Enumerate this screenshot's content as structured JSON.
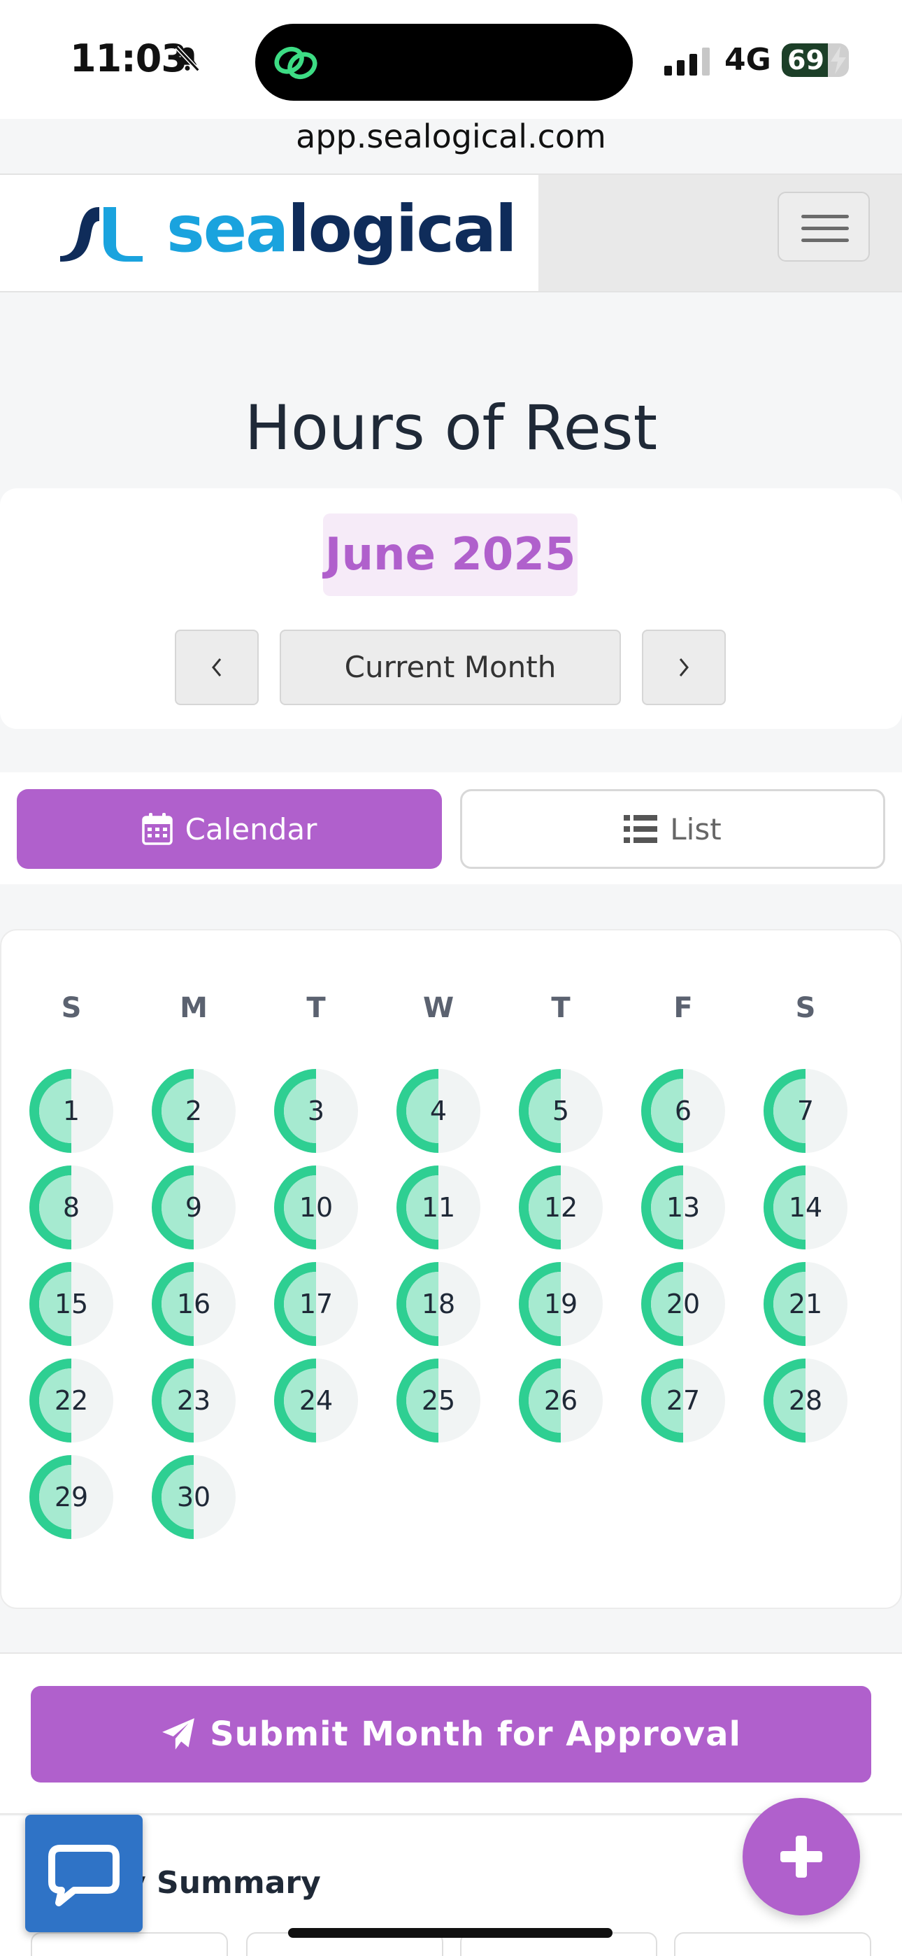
{
  "status_bar": {
    "time": "11:03",
    "network": "4G",
    "battery": "69",
    "battery_level": 0.69
  },
  "browser": {
    "url": "app.sealogical.com"
  },
  "header": {
    "logo_sea": "sea",
    "logo_logical": "logical"
  },
  "page": {
    "title": "Hours of Rest"
  },
  "month_nav": {
    "month_label": "June 2025",
    "prev_label": "‹",
    "current_label": "Current Month",
    "next_label": "›"
  },
  "view_toggle": {
    "calendar_label": "Calendar",
    "list_label": "List",
    "active": "calendar"
  },
  "calendar": {
    "weekdays": [
      "S",
      "M",
      "T",
      "W",
      "T",
      "F",
      "S"
    ],
    "first_weekday_index": 0,
    "days": [
      {
        "day": "1",
        "rest_fraction": 0.5
      },
      {
        "day": "2",
        "rest_fraction": 0.5
      },
      {
        "day": "3",
        "rest_fraction": 0.5
      },
      {
        "day": "4",
        "rest_fraction": 0.5
      },
      {
        "day": "5",
        "rest_fraction": 0.5
      },
      {
        "day": "6",
        "rest_fraction": 0.5
      },
      {
        "day": "7",
        "rest_fraction": 0.5
      },
      {
        "day": "8",
        "rest_fraction": 0.5
      },
      {
        "day": "9",
        "rest_fraction": 0.5
      },
      {
        "day": "10",
        "rest_fraction": 0.5
      },
      {
        "day": "11",
        "rest_fraction": 0.5
      },
      {
        "day": "12",
        "rest_fraction": 0.5
      },
      {
        "day": "13",
        "rest_fraction": 0.5
      },
      {
        "day": "14",
        "rest_fraction": 0.5
      },
      {
        "day": "15",
        "rest_fraction": 0.5
      },
      {
        "day": "16",
        "rest_fraction": 0.5
      },
      {
        "day": "17",
        "rest_fraction": 0.5
      },
      {
        "day": "18",
        "rest_fraction": 0.5
      },
      {
        "day": "19",
        "rest_fraction": 0.5
      },
      {
        "day": "20",
        "rest_fraction": 0.5
      },
      {
        "day": "21",
        "rest_fraction": 0.5
      },
      {
        "day": "22",
        "rest_fraction": 0.5
      },
      {
        "day": "23",
        "rest_fraction": 0.5
      },
      {
        "day": "24",
        "rest_fraction": 0.5
      },
      {
        "day": "25",
        "rest_fraction": 0.5
      },
      {
        "day": "26",
        "rest_fraction": 0.5
      },
      {
        "day": "27",
        "rest_fraction": 0.5
      },
      {
        "day": "28",
        "rest_fraction": 0.5
      },
      {
        "day": "29",
        "rest_fraction": 0.5
      },
      {
        "day": "30",
        "rest_fraction": 0.5
      }
    ]
  },
  "actions": {
    "submit_label": "Submit Month for Approval"
  },
  "summary": {
    "title_visible": "y Summary"
  },
  "icons": {
    "bell": "bell-slash-icon",
    "calendar": "calendar-icon",
    "list": "list-icon",
    "submit": "paper-plane-icon",
    "chat": "chat-bubble-icon",
    "fab": "plus-icon",
    "menu": "hamburger-menu-icon"
  },
  "colors": {
    "accent": "#b060cc",
    "accent_light": "#f6ebf8",
    "ring_green": "#2ecf92",
    "ring_green_light": "#a6ead0",
    "ring_track": "#f1f4f4",
    "chat_blue": "#2f73c6",
    "logo_light": "#1aa3de",
    "logo_dark": "#0f2c5a"
  }
}
